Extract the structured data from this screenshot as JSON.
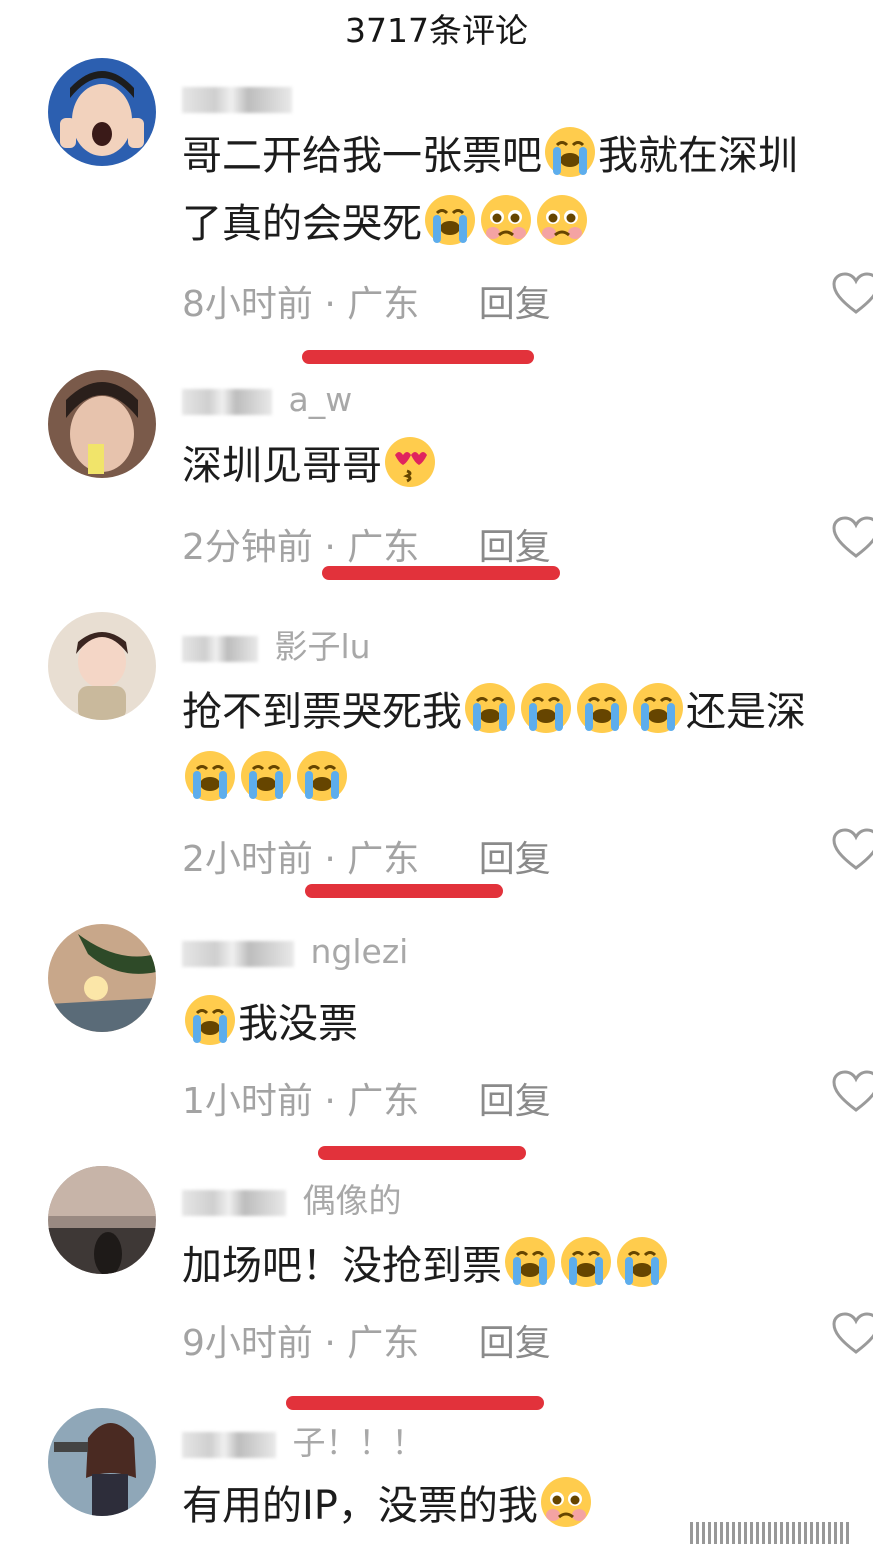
{
  "header": {
    "title": "3717条评论"
  },
  "comments": [
    {
      "username": "",
      "text_lines": [
        "哥二开给我一张票吧😭我就在深圳",
        "了真的会哭死😭🥹🥺"
      ],
      "time": "8小时前",
      "location": "广东",
      "reply": "回复"
    },
    {
      "username": "a_w",
      "text_lines": [
        "深圳见哥哥😍"
      ],
      "time": "2分钟前",
      "location": "广东",
      "reply": "回复"
    },
    {
      "username": "影子lu",
      "text_lines": [
        "抢不到票哭死我😭😭😭😭还是深",
        "😭😭😭"
      ],
      "time": "2小时前",
      "location": "广东",
      "reply": "回复"
    },
    {
      "username": "nglezi",
      "text_lines": [
        "😭我没票"
      ],
      "time": "1小时前",
      "location": "广东",
      "reply": "回复"
    },
    {
      "username": "偶像的",
      "text_lines": [
        "加场吧！没抢到票😭😭😭"
      ],
      "time": "9小时前",
      "location": "广东",
      "reply": "回复"
    },
    {
      "username": "子！！！",
      "text_lines": [
        "有用的IP，没票的我🥹"
      ],
      "time": "",
      "location": "",
      "reply": ""
    }
  ],
  "colors": {
    "underline": "#e2323b",
    "meta_text": "#a3a3a3",
    "username_text": "#a8a8a8"
  },
  "icons": [
    "crying-emoji-icon",
    "pleading-emoji-icon",
    "heart-eyes-kiss-emoji-icon",
    "like-heart-icon"
  ]
}
